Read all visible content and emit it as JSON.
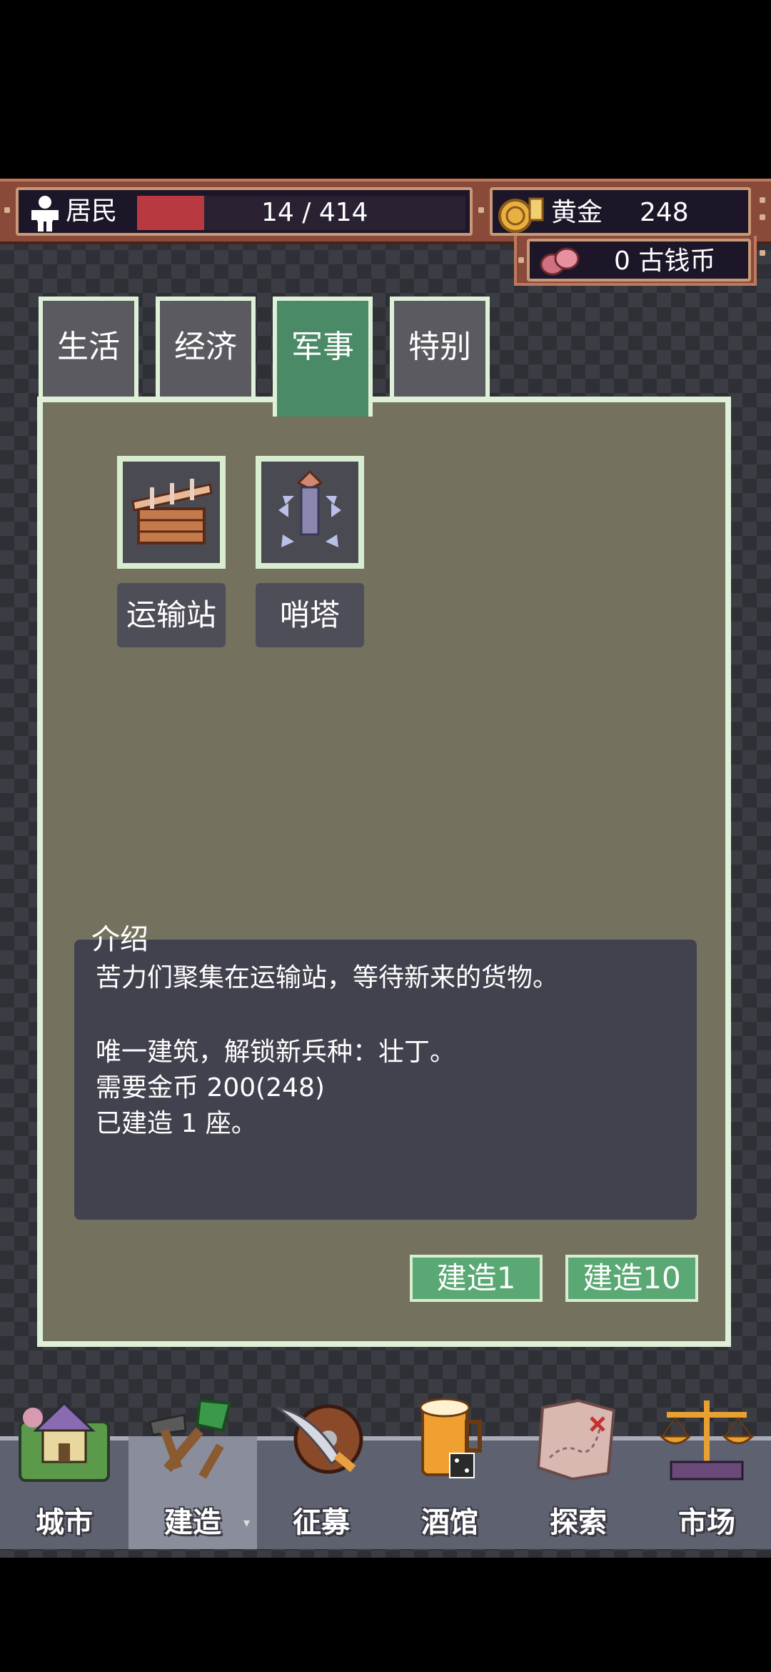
{
  "resources": {
    "residents_label": "居民",
    "residents_value": "14 / 414",
    "residents_fill_fraction": 0.034,
    "gold_label": "黄金",
    "gold_value": "248",
    "coins_value": "0 古钱币"
  },
  "tabs": [
    {
      "label": "生活",
      "active": false
    },
    {
      "label": "经济",
      "active": false
    },
    {
      "label": "军事",
      "active": true
    },
    {
      "label": "特别",
      "active": false
    }
  ],
  "buildings": [
    {
      "name": "运输站",
      "icon": "transport-station-icon"
    },
    {
      "name": "哨塔",
      "icon": "watchtower-icon"
    }
  ],
  "intro": {
    "title": "介绍",
    "lines": [
      "苦力们聚集在运输站，等待新来的货物。",
      "",
      "唯一建筑，解锁新兵种：壮丁。",
      "需要金币 200(248)",
      "已建造 1 座。"
    ]
  },
  "actions": {
    "build_one": "建造1",
    "build_ten": "建造10"
  },
  "nav": [
    {
      "label": "城市",
      "icon": "city-icon",
      "active": false
    },
    {
      "label": "建造",
      "icon": "build-shovel-icon",
      "active": true
    },
    {
      "label": "征募",
      "icon": "recruit-sword-shield-icon",
      "active": false
    },
    {
      "label": "酒馆",
      "icon": "tavern-beer-icon",
      "active": false
    },
    {
      "label": "探索",
      "icon": "explore-map-icon",
      "active": false
    },
    {
      "label": "市场",
      "icon": "market-scales-icon",
      "active": false
    }
  ],
  "colors": {
    "active_tab": "#4a8a66",
    "panel": "#74725e",
    "button": "#5aa874",
    "hp_bar": "#b83a40"
  }
}
